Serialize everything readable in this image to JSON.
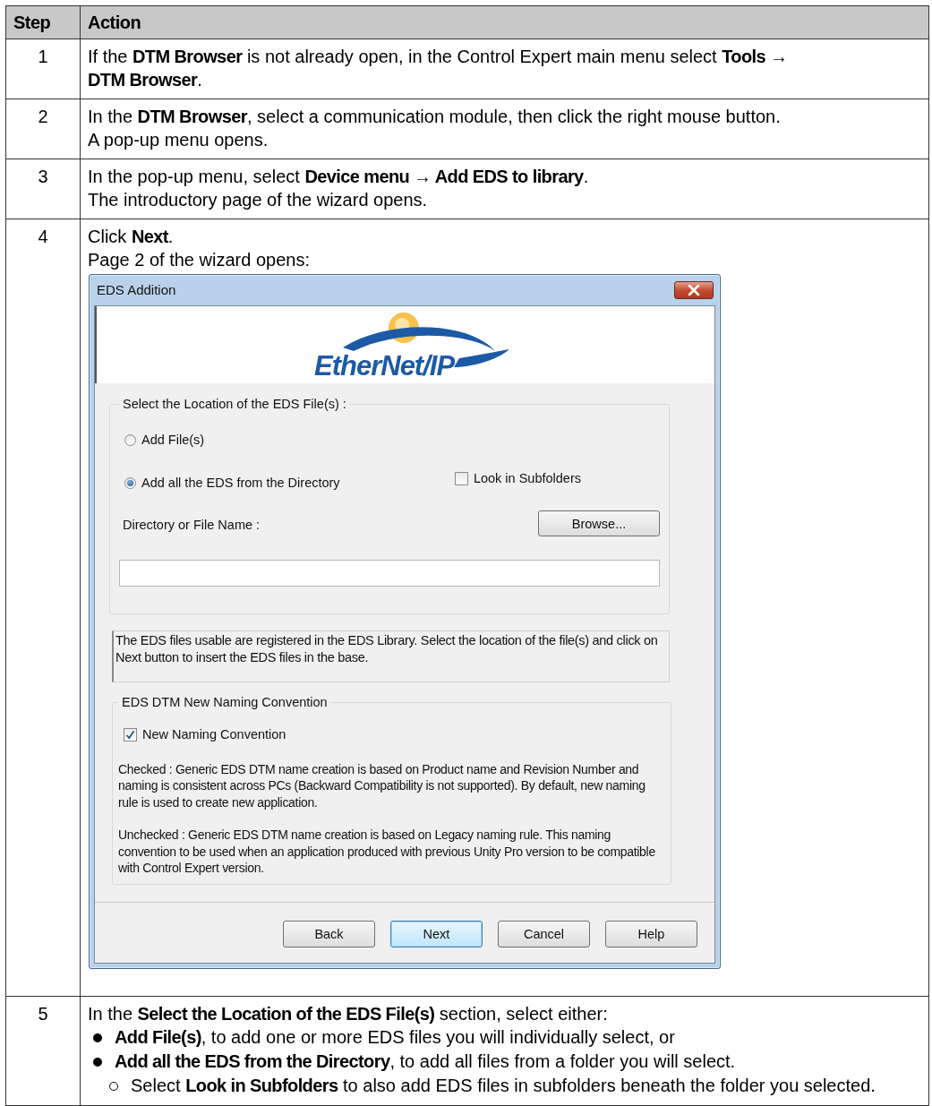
{
  "table": {
    "columns": [
      "Step",
      "Action"
    ],
    "rows": [
      {
        "step": "1",
        "lines": [
          "If the **DTM Browser** is not already open, in the Control Expert main menu select **Tools →**",
          "**DTM Browser**."
        ]
      },
      {
        "step": "2",
        "lines": [
          "In the **DTM Browser**, select a communication module, then click the right mouse button.",
          "A pop-up menu opens."
        ]
      },
      {
        "step": "3",
        "lines": [
          "In the pop-up menu, select **Device menu → Add EDS to library**.",
          "The introductory page of the wizard opens."
        ]
      },
      {
        "step": "4",
        "lines": [
          "Click **Next**.",
          "Page 2 of the wizard opens:"
        ],
        "dialog": {
          "title": "EDS Addition",
          "logo_text": "EtherNet/IP",
          "location_group": {
            "legend": "Select the Location of the EDS File(s) :",
            "options": [
              {
                "label": "Add File(s)",
                "selected": false
              },
              {
                "label": "Add all the EDS from the Directory",
                "selected": true
              }
            ],
            "subfolders": {
              "label": "Look in Subfolders",
              "checked": false
            },
            "path_label": "Directory or File Name :",
            "browse_button": "Browse..."
          },
          "info": "The EDS files usable are registered in the EDS Library. Select the location of the file(s) and click on Next button to insert the EDS files in the base.",
          "naming_group": {
            "legend": "EDS DTM New Naming Convention",
            "checkbox": {
              "label": "New Naming Convention",
              "checked": true
            },
            "paragraphs": [
              "Checked : Generic EDS DTM name creation is based on Product name and Revision Number and naming is consistent across PCs (Backward Compatibility is not supported). By default, new naming rule is used to create new application.",
              "Unchecked : Generic EDS DTM name creation is based on Legacy naming rule. This naming convention to be used when an application produced with previous Unity Pro version to be compatible with Control Expert version."
            ]
          },
          "buttons": [
            {
              "label": "Back",
              "default": false
            },
            {
              "label": "Next",
              "default": true
            },
            {
              "label": "Cancel",
              "default": false
            },
            {
              "label": "Help",
              "default": false
            }
          ]
        }
      },
      {
        "step": "5",
        "lines": [
          "In the **Select the Location of the EDS File(s)** section, select either:"
        ],
        "bullets": [
          {
            "text": "**Add File(s)**, to add one or more EDS files you will individually select, or"
          },
          {
            "text": "**Add all the EDS from the Directory**, to add all files from a folder you will select.",
            "children": [
              {
                "text": "Select **Look in Subfolders** to also add EDS files in subfolders beneath the folder you selected."
              }
            ]
          }
        ]
      }
    ]
  }
}
